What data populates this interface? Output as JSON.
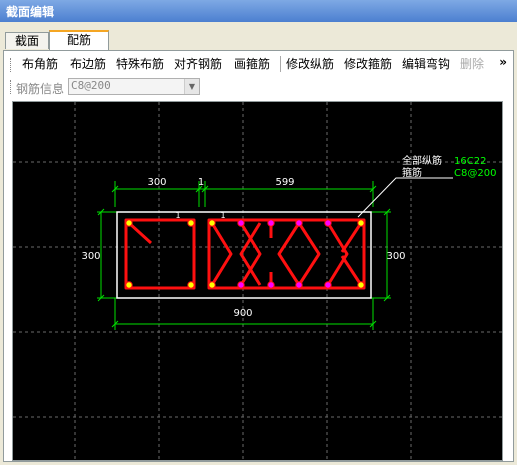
{
  "window": {
    "title": "截面编辑"
  },
  "tabs": [
    {
      "label": "截面"
    },
    {
      "label": "配筋"
    }
  ],
  "toolbar": {
    "items": [
      "布角筋",
      "布边筋",
      "特殊布筋",
      "对齐钢筋",
      "画箍筋",
      "修改纵筋",
      "修改箍筋",
      "编辑弯钩",
      "删除"
    ],
    "more": "»"
  },
  "rebar_info": {
    "label": "钢筋信息",
    "value": "C8@200"
  },
  "drawing": {
    "dims": {
      "top_left": "300",
      "top_mid": "1",
      "top_right": "599",
      "left": "300",
      "right": "300",
      "bottom": "900",
      "small1": "1",
      "small2": "1"
    },
    "annotation": {
      "line1_label": "全部纵筋",
      "line1_value": "16C22",
      "line2_label": "箍筋",
      "line2_value": "C8@200"
    },
    "colors": {
      "background": "#000000",
      "section": "#ffffff",
      "stirrup": "#ff1010",
      "rebar": "#ffff00",
      "dimension": "#00ff00",
      "grid": "#808080"
    }
  }
}
